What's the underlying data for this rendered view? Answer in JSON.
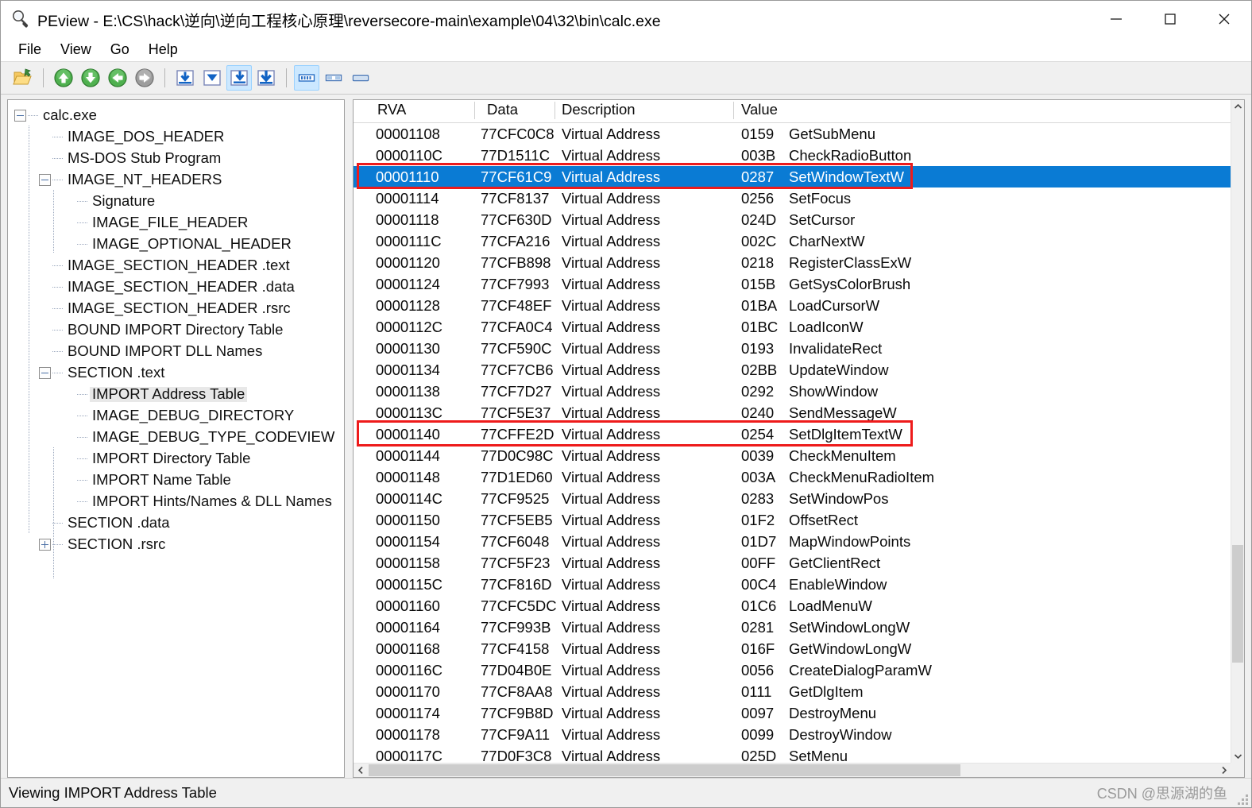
{
  "window": {
    "title": "PEview - E:\\CS\\hack\\逆向\\逆向工程核心原理\\reversecore-main\\example\\04\\32\\bin\\calc.exe",
    "icon": "magnifier-icon",
    "minimize_label": "Minimize",
    "maximize_label": "Maximize",
    "close_label": "Close"
  },
  "menu": {
    "items": [
      {
        "label": "File"
      },
      {
        "label": "View"
      },
      {
        "label": "Go"
      },
      {
        "label": "Help"
      }
    ]
  },
  "toolbar": {
    "buttons": [
      {
        "name": "open-file-icon",
        "state": "normal"
      },
      {
        "name": "go-up-icon",
        "state": "normal"
      },
      {
        "name": "go-down-icon",
        "state": "normal"
      },
      {
        "name": "go-back-icon",
        "state": "normal"
      },
      {
        "name": "go-forward-icon",
        "state": "disabled"
      },
      {
        "name": "view-headers-icon",
        "state": "normal"
      },
      {
        "name": "view-sections-icon",
        "state": "normal"
      },
      {
        "name": "view-imports-icon",
        "state": "active"
      },
      {
        "name": "view-exports-icon",
        "state": "normal"
      },
      {
        "name": "view-hex-icon",
        "state": "active"
      },
      {
        "name": "view-split-icon",
        "state": "normal"
      },
      {
        "name": "view-single-icon",
        "state": "normal"
      }
    ]
  },
  "tree": {
    "nodes": [
      {
        "label": "calc.exe",
        "depth": 0,
        "expander": "minus",
        "selected": false
      },
      {
        "label": "IMAGE_DOS_HEADER",
        "depth": 1,
        "expander": "none",
        "selected": false
      },
      {
        "label": "MS-DOS Stub Program",
        "depth": 1,
        "expander": "none",
        "selected": false
      },
      {
        "label": "IMAGE_NT_HEADERS",
        "depth": 1,
        "expander": "minus",
        "selected": false
      },
      {
        "label": "Signature",
        "depth": 2,
        "expander": "none",
        "selected": false
      },
      {
        "label": "IMAGE_FILE_HEADER",
        "depth": 2,
        "expander": "none",
        "selected": false
      },
      {
        "label": "IMAGE_OPTIONAL_HEADER",
        "depth": 2,
        "expander": "none",
        "selected": false
      },
      {
        "label": "IMAGE_SECTION_HEADER .text",
        "depth": 1,
        "expander": "none",
        "selected": false
      },
      {
        "label": "IMAGE_SECTION_HEADER .data",
        "depth": 1,
        "expander": "none",
        "selected": false
      },
      {
        "label": "IMAGE_SECTION_HEADER .rsrc",
        "depth": 1,
        "expander": "none",
        "selected": false
      },
      {
        "label": "BOUND IMPORT Directory Table",
        "depth": 1,
        "expander": "none",
        "selected": false
      },
      {
        "label": "BOUND IMPORT DLL Names",
        "depth": 1,
        "expander": "none",
        "selected": false
      },
      {
        "label": "SECTION .text",
        "depth": 1,
        "expander": "minus",
        "selected": false
      },
      {
        "label": "IMPORT Address Table",
        "depth": 2,
        "expander": "none",
        "selected": true
      },
      {
        "label": "IMAGE_DEBUG_DIRECTORY",
        "depth": 2,
        "expander": "none",
        "selected": false
      },
      {
        "label": "IMAGE_DEBUG_TYPE_CODEVIEW",
        "depth": 2,
        "expander": "none",
        "selected": false
      },
      {
        "label": "IMPORT Directory Table",
        "depth": 2,
        "expander": "none",
        "selected": false
      },
      {
        "label": "IMPORT Name Table",
        "depth": 2,
        "expander": "none",
        "selected": false
      },
      {
        "label": "IMPORT Hints/Names & DLL Names",
        "depth": 2,
        "expander": "none",
        "selected": false
      },
      {
        "label": "SECTION .data",
        "depth": 1,
        "expander": "none",
        "selected": false
      },
      {
        "label": "SECTION .rsrc",
        "depth": 1,
        "expander": "plus",
        "selected": false
      }
    ]
  },
  "list": {
    "columns": [
      {
        "label": "RVA"
      },
      {
        "label": "Data"
      },
      {
        "label": "Description"
      },
      {
        "label": "Value"
      }
    ],
    "rows": [
      {
        "rva": "00001108",
        "data": "77CFC0C8",
        "description": "Virtual Address",
        "ordinal": "0159",
        "value": "GetSubMenu",
        "selected": false,
        "boxed": false
      },
      {
        "rva": "0000110C",
        "data": "77D1511C",
        "description": "Virtual Address",
        "ordinal": "003B",
        "value": "CheckRadioButton",
        "selected": false,
        "boxed": false
      },
      {
        "rva": "00001110",
        "data": "77CF61C9",
        "description": "Virtual Address",
        "ordinal": "0287",
        "value": "SetWindowTextW",
        "selected": true,
        "boxed": true
      },
      {
        "rva": "00001114",
        "data": "77CF8137",
        "description": "Virtual Address",
        "ordinal": "0256",
        "value": "SetFocus",
        "selected": false,
        "boxed": false
      },
      {
        "rva": "00001118",
        "data": "77CF630D",
        "description": "Virtual Address",
        "ordinal": "024D",
        "value": "SetCursor",
        "selected": false,
        "boxed": false
      },
      {
        "rva": "0000111C",
        "data": "77CFA216",
        "description": "Virtual Address",
        "ordinal": "002C",
        "value": "CharNextW",
        "selected": false,
        "boxed": false
      },
      {
        "rva": "00001120",
        "data": "77CFB898",
        "description": "Virtual Address",
        "ordinal": "0218",
        "value": "RegisterClassExW",
        "selected": false,
        "boxed": false
      },
      {
        "rva": "00001124",
        "data": "77CF7993",
        "description": "Virtual Address",
        "ordinal": "015B",
        "value": "GetSysColorBrush",
        "selected": false,
        "boxed": false
      },
      {
        "rva": "00001128",
        "data": "77CF48EF",
        "description": "Virtual Address",
        "ordinal": "01BA",
        "value": "LoadCursorW",
        "selected": false,
        "boxed": false
      },
      {
        "rva": "0000112C",
        "data": "77CFA0C4",
        "description": "Virtual Address",
        "ordinal": "01BC",
        "value": "LoadIconW",
        "selected": false,
        "boxed": false
      },
      {
        "rva": "00001130",
        "data": "77CF590C",
        "description": "Virtual Address",
        "ordinal": "0193",
        "value": "InvalidateRect",
        "selected": false,
        "boxed": false
      },
      {
        "rva": "00001134",
        "data": "77CF7CB6",
        "description": "Virtual Address",
        "ordinal": "02BB",
        "value": "UpdateWindow",
        "selected": false,
        "boxed": false
      },
      {
        "rva": "00001138",
        "data": "77CF7D27",
        "description": "Virtual Address",
        "ordinal": "0292",
        "value": "ShowWindow",
        "selected": false,
        "boxed": false
      },
      {
        "rva": "0000113C",
        "data": "77CF5E37",
        "description": "Virtual Address",
        "ordinal": "0240",
        "value": "SendMessageW",
        "selected": false,
        "boxed": false
      },
      {
        "rva": "00001140",
        "data": "77CFFE2D",
        "description": "Virtual Address",
        "ordinal": "0254",
        "value": "SetDlgItemTextW",
        "selected": false,
        "boxed": true
      },
      {
        "rva": "00001144",
        "data": "77D0C98C",
        "description": "Virtual Address",
        "ordinal": "0039",
        "value": "CheckMenuItem",
        "selected": false,
        "boxed": false
      },
      {
        "rva": "00001148",
        "data": "77D1ED60",
        "description": "Virtual Address",
        "ordinal": "003A",
        "value": "CheckMenuRadioItem",
        "selected": false,
        "boxed": false
      },
      {
        "rva": "0000114C",
        "data": "77CF9525",
        "description": "Virtual Address",
        "ordinal": "0283",
        "value": "SetWindowPos",
        "selected": false,
        "boxed": false
      },
      {
        "rva": "00001150",
        "data": "77CF5EB5",
        "description": "Virtual Address",
        "ordinal": "01F2",
        "value": "OffsetRect",
        "selected": false,
        "boxed": false
      },
      {
        "rva": "00001154",
        "data": "77CF6048",
        "description": "Virtual Address",
        "ordinal": "01D7",
        "value": "MapWindowPoints",
        "selected": false,
        "boxed": false
      },
      {
        "rva": "00001158",
        "data": "77CF5F23",
        "description": "Virtual Address",
        "ordinal": "00FF",
        "value": "GetClientRect",
        "selected": false,
        "boxed": false
      },
      {
        "rva": "0000115C",
        "data": "77CF816D",
        "description": "Virtual Address",
        "ordinal": "00C4",
        "value": "EnableWindow",
        "selected": false,
        "boxed": false
      },
      {
        "rva": "00001160",
        "data": "77CFC5DC",
        "description": "Virtual Address",
        "ordinal": "01C6",
        "value": "LoadMenuW",
        "selected": false,
        "boxed": false
      },
      {
        "rva": "00001164",
        "data": "77CF993B",
        "description": "Virtual Address",
        "ordinal": "0281",
        "value": "SetWindowLongW",
        "selected": false,
        "boxed": false
      },
      {
        "rva": "00001168",
        "data": "77CF4158",
        "description": "Virtual Address",
        "ordinal": "016F",
        "value": "GetWindowLongW",
        "selected": false,
        "boxed": false
      },
      {
        "rva": "0000116C",
        "data": "77D04B0E",
        "description": "Virtual Address",
        "ordinal": "0056",
        "value": "CreateDialogParamW",
        "selected": false,
        "boxed": false
      },
      {
        "rva": "00001170",
        "data": "77CF8AA8",
        "description": "Virtual Address",
        "ordinal": "0111",
        "value": "GetDlgItem",
        "selected": false,
        "boxed": false
      },
      {
        "rva": "00001174",
        "data": "77CF9B8D",
        "description": "Virtual Address",
        "ordinal": "0097",
        "value": "DestroyMenu",
        "selected": false,
        "boxed": false
      },
      {
        "rva": "00001178",
        "data": "77CF9A11",
        "description": "Virtual Address",
        "ordinal": "0099",
        "value": "DestroyWindow",
        "selected": false,
        "boxed": false
      },
      {
        "rva": "0000117C",
        "data": "77D0F3C8",
        "description": "Virtual Address",
        "ordinal": "025D",
        "value": "SetMenu",
        "selected": false,
        "boxed": false
      }
    ]
  },
  "statusbar": {
    "text": "Viewing IMPORT Address Table",
    "watermark": "CSDN @思源湖的鱼"
  },
  "colors": {
    "selection": "#0a7bd4",
    "highlight_box": "#ee1b1b",
    "toolbar_active": "#cce8ff"
  }
}
